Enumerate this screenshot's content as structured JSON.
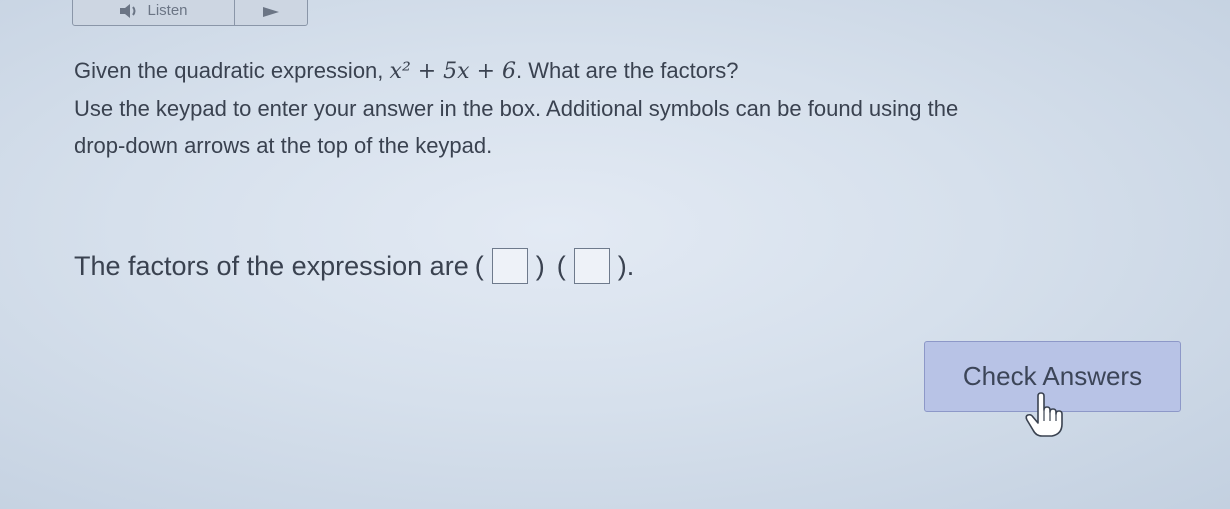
{
  "toolbar": {
    "listen_label": "Listen",
    "speaker_icon": "speaker-icon",
    "play_icon": "play-icon"
  },
  "question": {
    "line1_prefix": "Given the quadratic expression,",
    "expression": "x² + 5x + 6",
    "line1_suffix": ". What are the factors?",
    "line2": "Use the keypad to enter your answer in the box. Additional symbols can be found using the",
    "line3": "drop-down arrows at the top of the keypad."
  },
  "answer": {
    "prefix": "The factors of the expression are",
    "open_paren_1": "(",
    "close_paren_1": ")",
    "open_paren_2": "(",
    "close_paren_2": ").",
    "box1_value": "",
    "box2_value": ""
  },
  "check_button": {
    "label": "Check Answers"
  },
  "cursor": {
    "icon": "hand-pointer-icon"
  }
}
